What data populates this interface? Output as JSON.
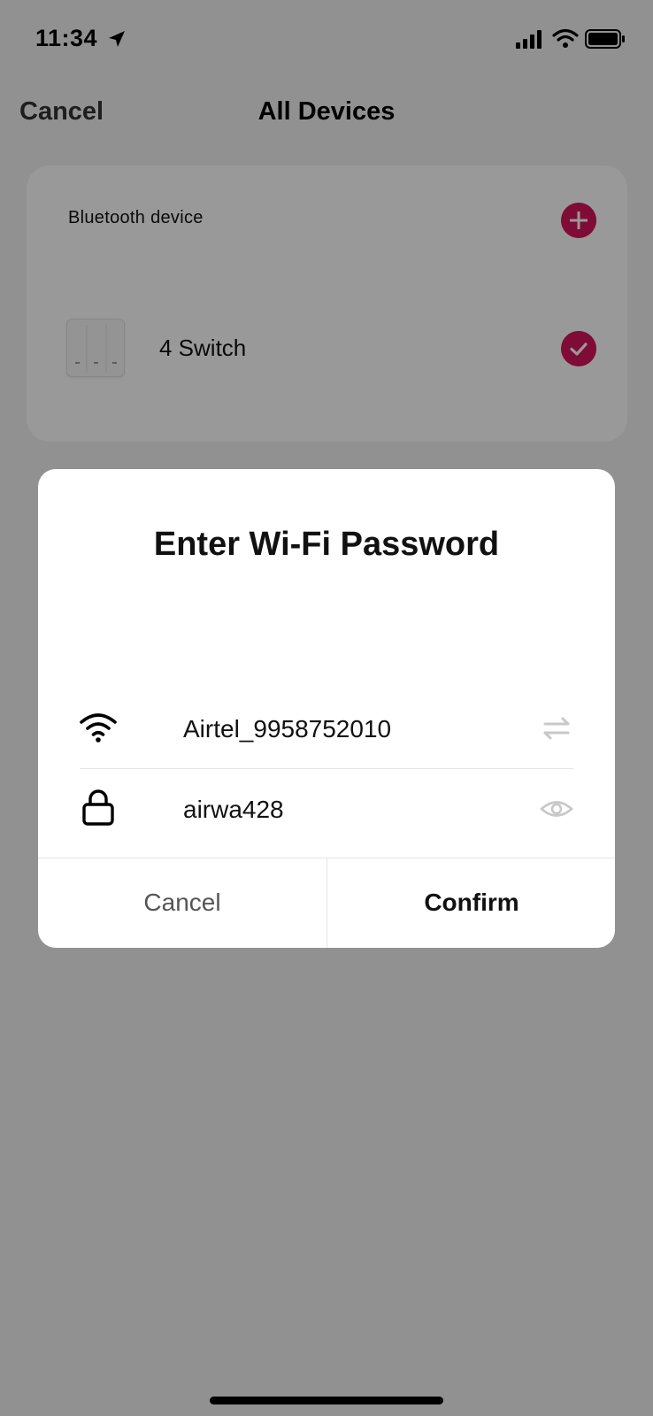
{
  "status_bar": {
    "time": "11:34",
    "icons": [
      "location-arrow-icon",
      "cellular-signal-icon",
      "wifi-icon",
      "battery-icon"
    ]
  },
  "nav": {
    "cancel_label": "Cancel",
    "title": "All Devices"
  },
  "device_list": {
    "section_label": "Bluetooth device",
    "devices": [
      {
        "name": "4 Switch",
        "selected": true
      }
    ]
  },
  "dialog": {
    "title": "Enter Wi-Fi Password",
    "ssid_value": "Airtel_9958752010",
    "password_value": "airwa428",
    "cancel_label": "Cancel",
    "confirm_label": "Confirm"
  },
  "colors": {
    "accent": "#d4145a",
    "overlay": "rgba(0,0,0,0.40)"
  }
}
